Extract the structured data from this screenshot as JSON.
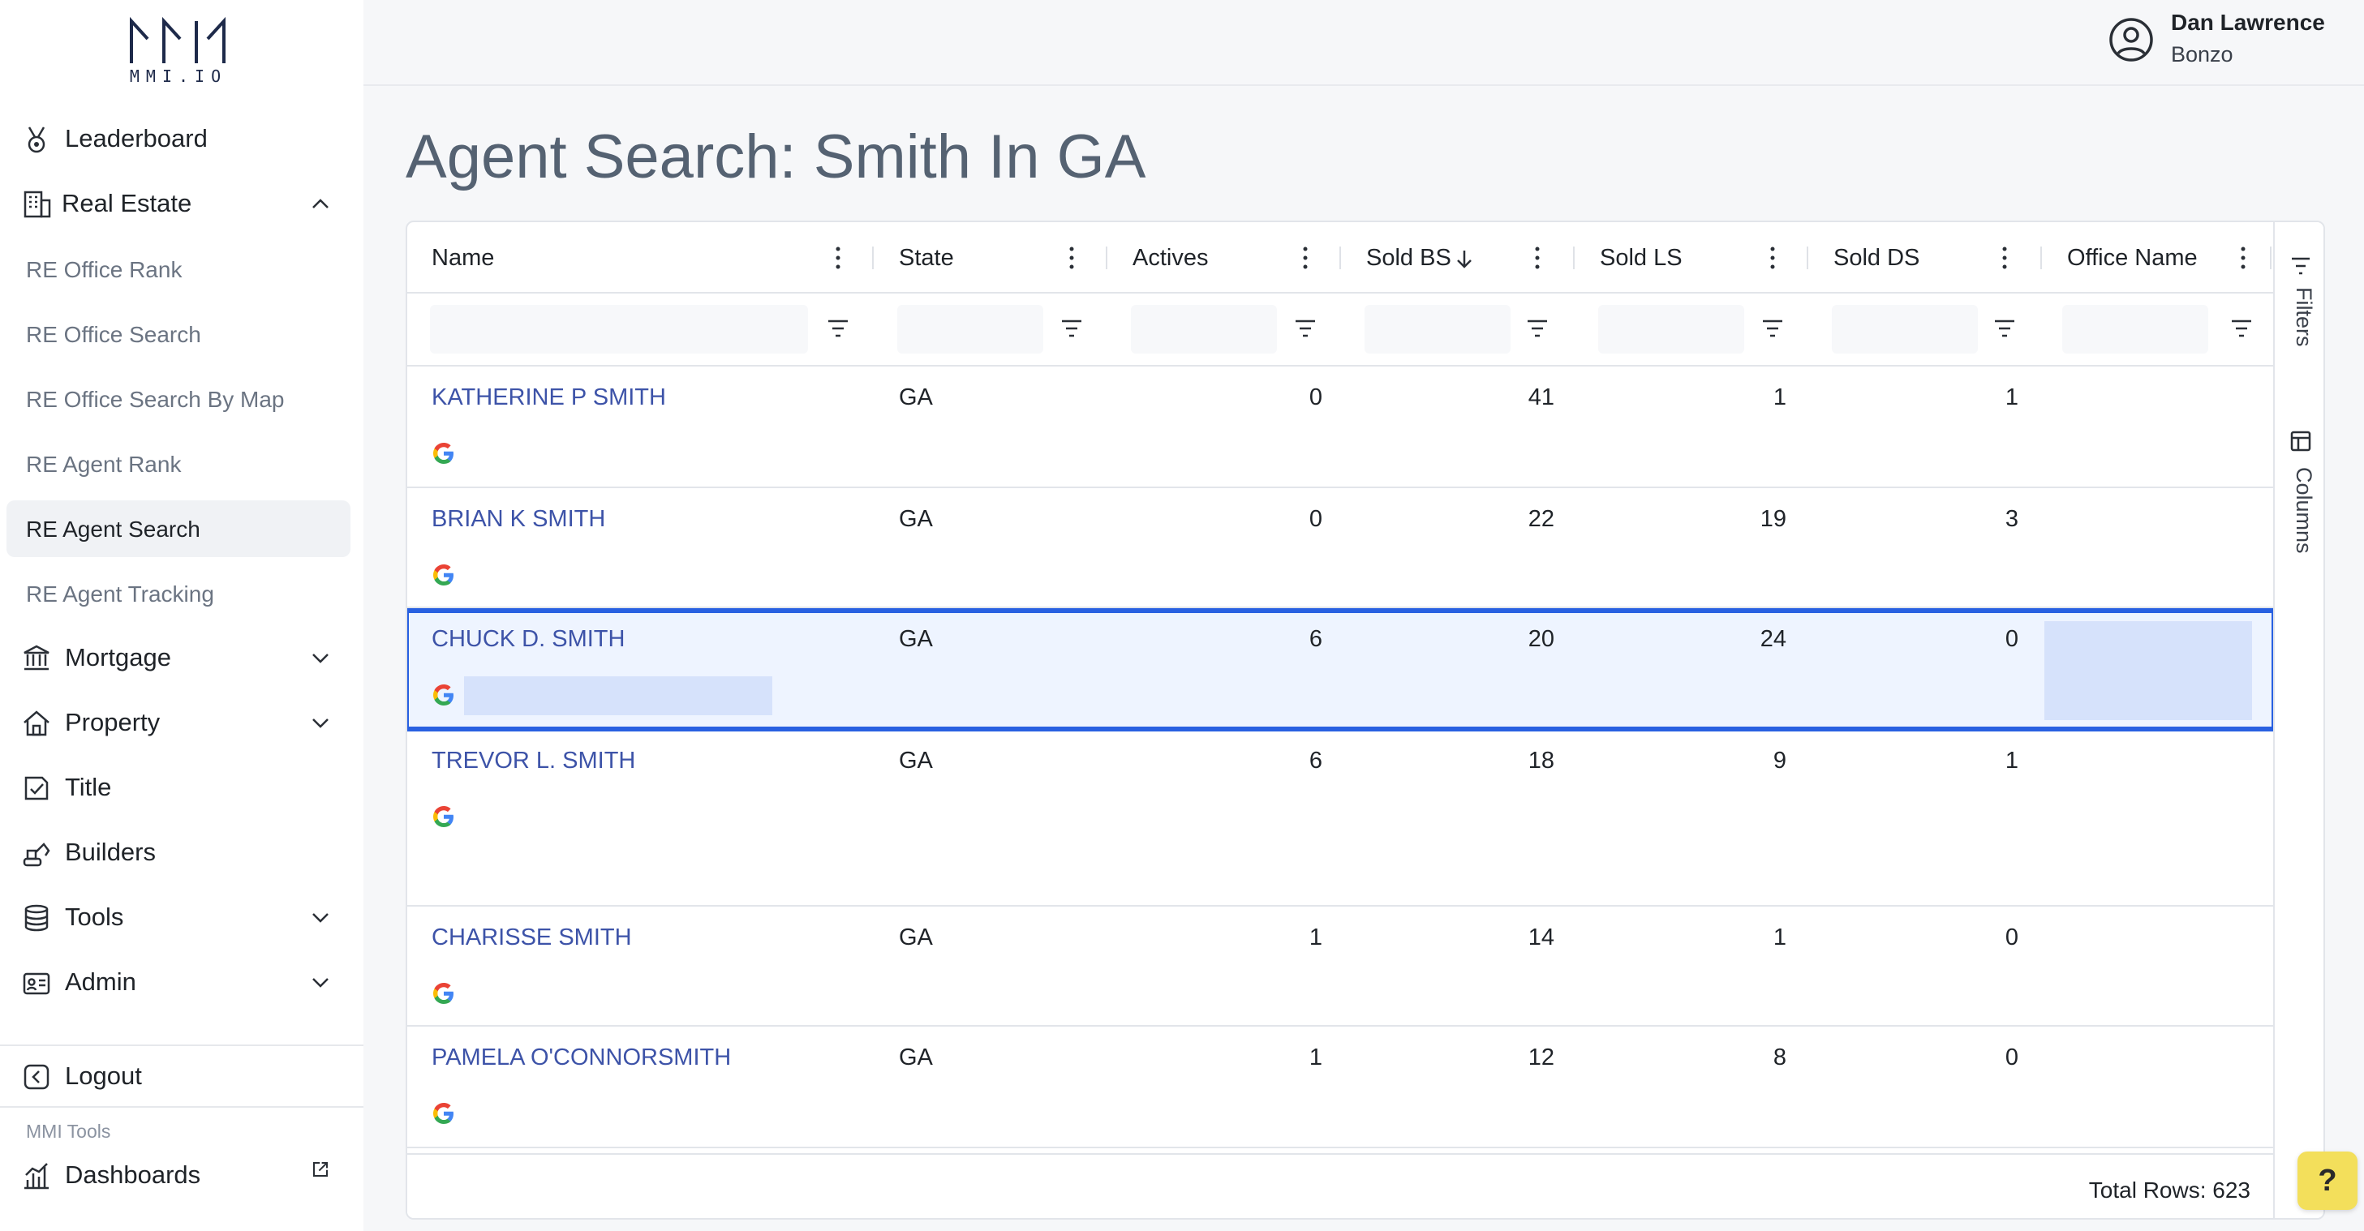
{
  "brand": {
    "logo_text": "MMI.IO"
  },
  "user": {
    "name": "Dan Lawrence",
    "org": "Bonzo"
  },
  "page": {
    "title": "Agent Search: Smith In GA"
  },
  "sidebar": {
    "items": [
      {
        "label": "Leaderboard",
        "icon": "medal-icon"
      },
      {
        "label": "Real Estate",
        "icon": "building-icon",
        "expanded": true
      },
      {
        "label": "Mortgage",
        "icon": "bank-icon",
        "expanded": false
      },
      {
        "label": "Property",
        "icon": "home-icon",
        "expanded": false
      },
      {
        "label": "Title",
        "icon": "badge-check-icon"
      },
      {
        "label": "Builders",
        "icon": "excavator-icon"
      },
      {
        "label": "Tools",
        "icon": "database-icon",
        "expanded": false
      },
      {
        "label": "Admin",
        "icon": "id-card-icon",
        "expanded": false
      }
    ],
    "subitems": [
      {
        "label": "RE Office Rank"
      },
      {
        "label": "RE Office Search"
      },
      {
        "label": "RE Office Search By Map"
      },
      {
        "label": "RE Agent Rank"
      },
      {
        "label": "RE Agent Search",
        "active": true
      },
      {
        "label": "RE Agent Tracking"
      }
    ],
    "logout": "Logout",
    "tools_caption": "MMI Tools",
    "dashboards": "Dashboards"
  },
  "grid": {
    "columns": [
      "Name",
      "State",
      "Actives",
      "Sold BS",
      "Sold LS",
      "Sold DS",
      "Office Name"
    ],
    "sort": {
      "column": "Sold BS",
      "direction": "desc"
    },
    "side_tabs": {
      "filters": "Filters",
      "columns": "Columns"
    },
    "rows": [
      {
        "name": "KATHERINE P SMITH",
        "state": "GA",
        "actives": "0",
        "sold_bs": "41",
        "sold_ls": "1",
        "sold_ds": "1"
      },
      {
        "name": "BRIAN K SMITH",
        "state": "GA",
        "actives": "0",
        "sold_bs": "22",
        "sold_ls": "19",
        "sold_ds": "3"
      },
      {
        "name": "CHUCK D. SMITH",
        "state": "GA",
        "actives": "6",
        "sold_bs": "20",
        "sold_ls": "24",
        "sold_ds": "0",
        "selected": true
      },
      {
        "name": "TREVOR L. SMITH",
        "state": "GA",
        "actives": "6",
        "sold_bs": "18",
        "sold_ls": "9",
        "sold_ds": "1"
      },
      {
        "name": "CHARISSE SMITH",
        "state": "GA",
        "actives": "1",
        "sold_bs": "14",
        "sold_ls": "1",
        "sold_ds": "0"
      },
      {
        "name": "PAMELA O'CONNORSMITH",
        "state": "GA",
        "actives": "1",
        "sold_bs": "12",
        "sold_ls": "8",
        "sold_ds": "0"
      }
    ],
    "total_rows": "Total Rows: 623"
  },
  "help": {
    "label": "?"
  },
  "colors": {
    "accent": "#2860e1",
    "link": "#3d53a8",
    "help": "#f3df5b"
  }
}
